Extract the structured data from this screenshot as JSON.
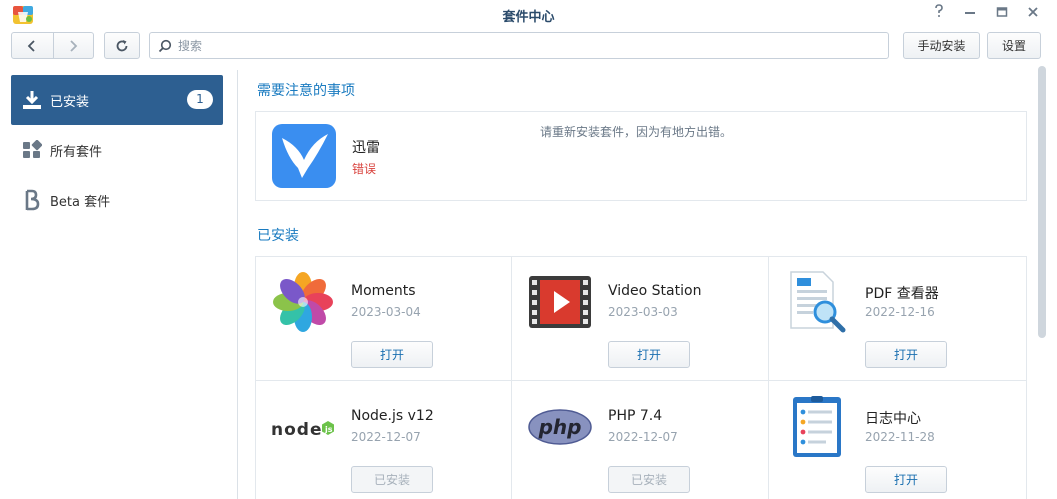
{
  "window": {
    "title": "套件中心",
    "controls": [
      "help-icon",
      "minimize-icon",
      "maximize-icon",
      "close-icon"
    ]
  },
  "toolbar": {
    "search_placeholder": "搜索",
    "manual_install_label": "手动安装",
    "settings_label": "设置"
  },
  "sidebar": {
    "items": [
      {
        "label": "已安装",
        "icon": "download-icon",
        "badge": "1",
        "active": true
      },
      {
        "label": "所有套件",
        "icon": "grid-icon",
        "active": false
      },
      {
        "label": "Beta 套件",
        "icon": "beta-icon",
        "active": false
      }
    ]
  },
  "main": {
    "attention_title": "需要注意的事项",
    "attention": {
      "name": "迅雷",
      "status": "错误",
      "message": "请重新安装套件，因为有地方出错。",
      "icon": "thunder-bird-icon"
    },
    "installed_title": "已安装",
    "packages": [
      {
        "name": "Moments",
        "date": "2023-03-04",
        "button": "打开",
        "enabled": true,
        "icon": "moments-icon"
      },
      {
        "name": "Video Station",
        "date": "2023-03-03",
        "button": "打开",
        "enabled": true,
        "icon": "video-station-icon"
      },
      {
        "name": "PDF 查看器",
        "date": "2022-12-16",
        "button": "打开",
        "enabled": true,
        "icon": "pdf-viewer-icon"
      },
      {
        "name": "Node.js v12",
        "date": "2022-12-07",
        "button": "已安装",
        "enabled": false,
        "icon": "nodejs-icon"
      },
      {
        "name": "PHP 7.4",
        "date": "2022-12-07",
        "button": "已安装",
        "enabled": false,
        "icon": "php-icon"
      },
      {
        "name": "日志中心",
        "date": "2022-11-28",
        "button": "打开",
        "enabled": true,
        "icon": "log-center-icon"
      }
    ]
  },
  "colors": {
    "accent": "#2d5f91",
    "link": "#1a7bc0",
    "error": "#d9433e"
  }
}
